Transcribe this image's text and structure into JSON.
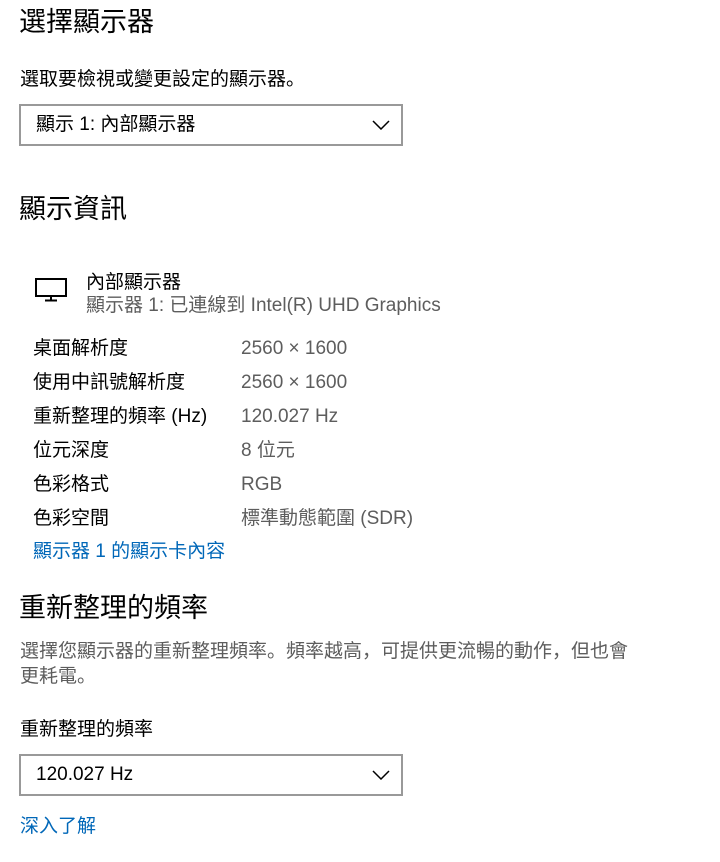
{
  "select_display": {
    "heading": "選擇顯示器",
    "label": "選取要檢視或變更設定的顯示器。",
    "dropdown_value": "顯示 1: 內部顯示器"
  },
  "display_info": {
    "heading": "顯示資訊",
    "name": "內部顯示器",
    "connection": "顯示器 1: 已連線到 Intel(R) UHD Graphics",
    "rows": [
      {
        "label": "桌面解析度",
        "value": "2560 × 1600"
      },
      {
        "label": "使用中訊號解析度",
        "value": "2560 × 1600"
      },
      {
        "label": "重新整理的頻率 (Hz)",
        "value": "120.027 Hz"
      },
      {
        "label": "位元深度",
        "value": "8 位元"
      },
      {
        "label": "色彩格式",
        "value": "RGB"
      },
      {
        "label": "色彩空間",
        "value": "標準動態範圍 (SDR)"
      }
    ],
    "adapter_link": "顯示器 1 的顯示卡內容"
  },
  "refresh_rate": {
    "heading": "重新整理的頻率",
    "description": "選擇您顯示器的重新整理頻率。頻率越高，可提供更流暢的動作，但也會更耗電。",
    "label": "重新整理的頻率",
    "dropdown_value": "120.027 Hz",
    "learn_more_link": "深入了解"
  },
  "icons": {
    "monitor": "monitor-icon",
    "chevron": "chevron-down-icon"
  },
  "colors": {
    "text": "#000000",
    "secondary_text": "#5d5d5d",
    "link": "#0067b8",
    "dropdown_border": "#999999",
    "background": "#ffffff"
  }
}
